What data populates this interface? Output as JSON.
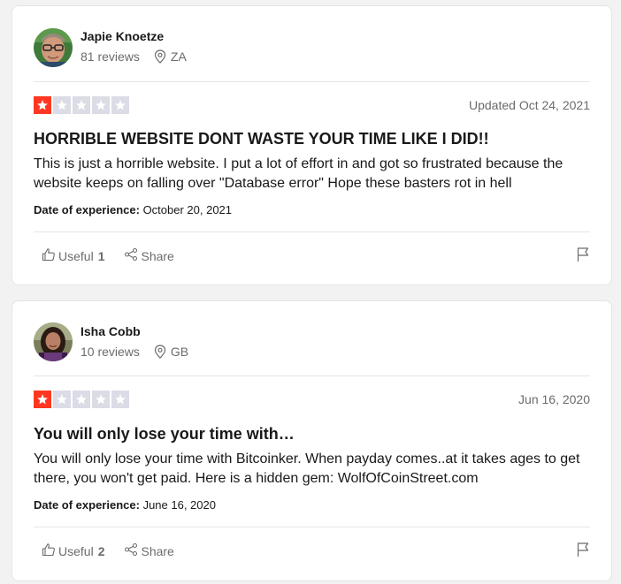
{
  "reviews": [
    {
      "reviewer_name": "Japie Knoetze",
      "reviews_count": "81 reviews",
      "country": "ZA",
      "rating": 1,
      "date_label": "Updated Oct 24, 2021",
      "title": "HORRIBLE WEBSITE DONT WASTE YOUR TIME LIKE I DID!!",
      "body": "This is just a horrible website. I put a lot of effort in and got so frustrated because the website keeps on falling over \"Database error\" Hope these basters rot in hell",
      "experience_label": "Date of experience:",
      "experience_date": "October 20, 2021",
      "useful_label": "Useful",
      "useful_count": "1",
      "share_label": "Share"
    },
    {
      "reviewer_name": "Isha Cobb",
      "reviews_count": "10 reviews",
      "country": "GB",
      "rating": 1,
      "date_label": "Jun 16, 2020",
      "title": "You will only lose your time with…",
      "body": "You will only lose your time with Bitcoinker. When payday comes..at it takes ages to get there, you won't get paid. Here is a hidden gem: WolfOfCoinStreet.com",
      "experience_label": "Date of experience:",
      "experience_date": "June 16, 2020",
      "useful_label": "Useful",
      "useful_count": "2",
      "share_label": "Share"
    }
  ],
  "colors": {
    "star_active": "#ff3722",
    "star_inactive": "#dcdce6",
    "text_secondary": "#6b6b6b"
  },
  "icons": [
    "location-pin-icon",
    "star-icon",
    "thumbs-up-icon",
    "share-icon",
    "flag-icon"
  ]
}
